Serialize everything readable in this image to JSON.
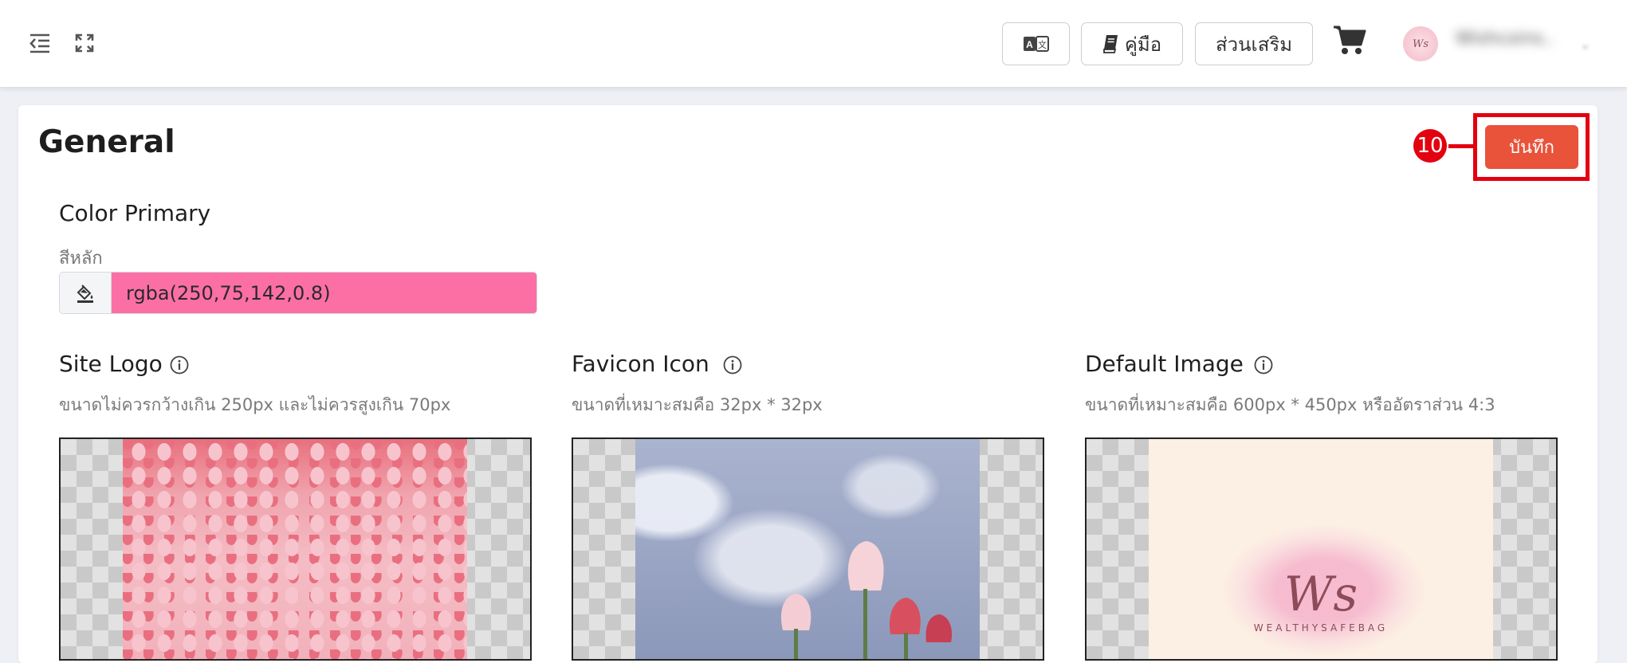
{
  "header": {
    "menu_icon": "menu-collapse-icon",
    "fullscreen_icon": "fullscreen-icon",
    "translate_icon": "translate-icon",
    "manual_label": "คู่มือ",
    "manual_icon": "book-icon",
    "addons_label": "ส่วนเสริม",
    "cart_icon": "cart-icon",
    "avatar_text": "Ws",
    "username": "Wishcoins..",
    "user_caret": "⌄"
  },
  "page": {
    "title": "General",
    "save_label": "บันทึก",
    "step_number": "10",
    "accent_color": "#e8533a",
    "highlight_color": "#e3000f"
  },
  "color_primary": {
    "title": "Color Primary",
    "sub_label": "สีหลัก",
    "value": "rgba(250,75,142,0.8)",
    "icon": "paint-bucket-icon"
  },
  "uploads": [
    {
      "title": "Site Logo",
      "hint": "ขนาดไม่ควรกว้างเกิน 250px และไม่ควรสูงเกิน 70px"
    },
    {
      "title": "Favicon Icon",
      "hint": "ขนาดที่เหมาะสมคือ 32px * 32px"
    },
    {
      "title": "Default Image",
      "hint": "ขนาดที่เหมาะสมคือ 600px * 450px หรืออัตราส่วน 4:3",
      "logo_mark": "Ws",
      "logo_caption": "WEALTHYSAFEBAG"
    }
  ]
}
